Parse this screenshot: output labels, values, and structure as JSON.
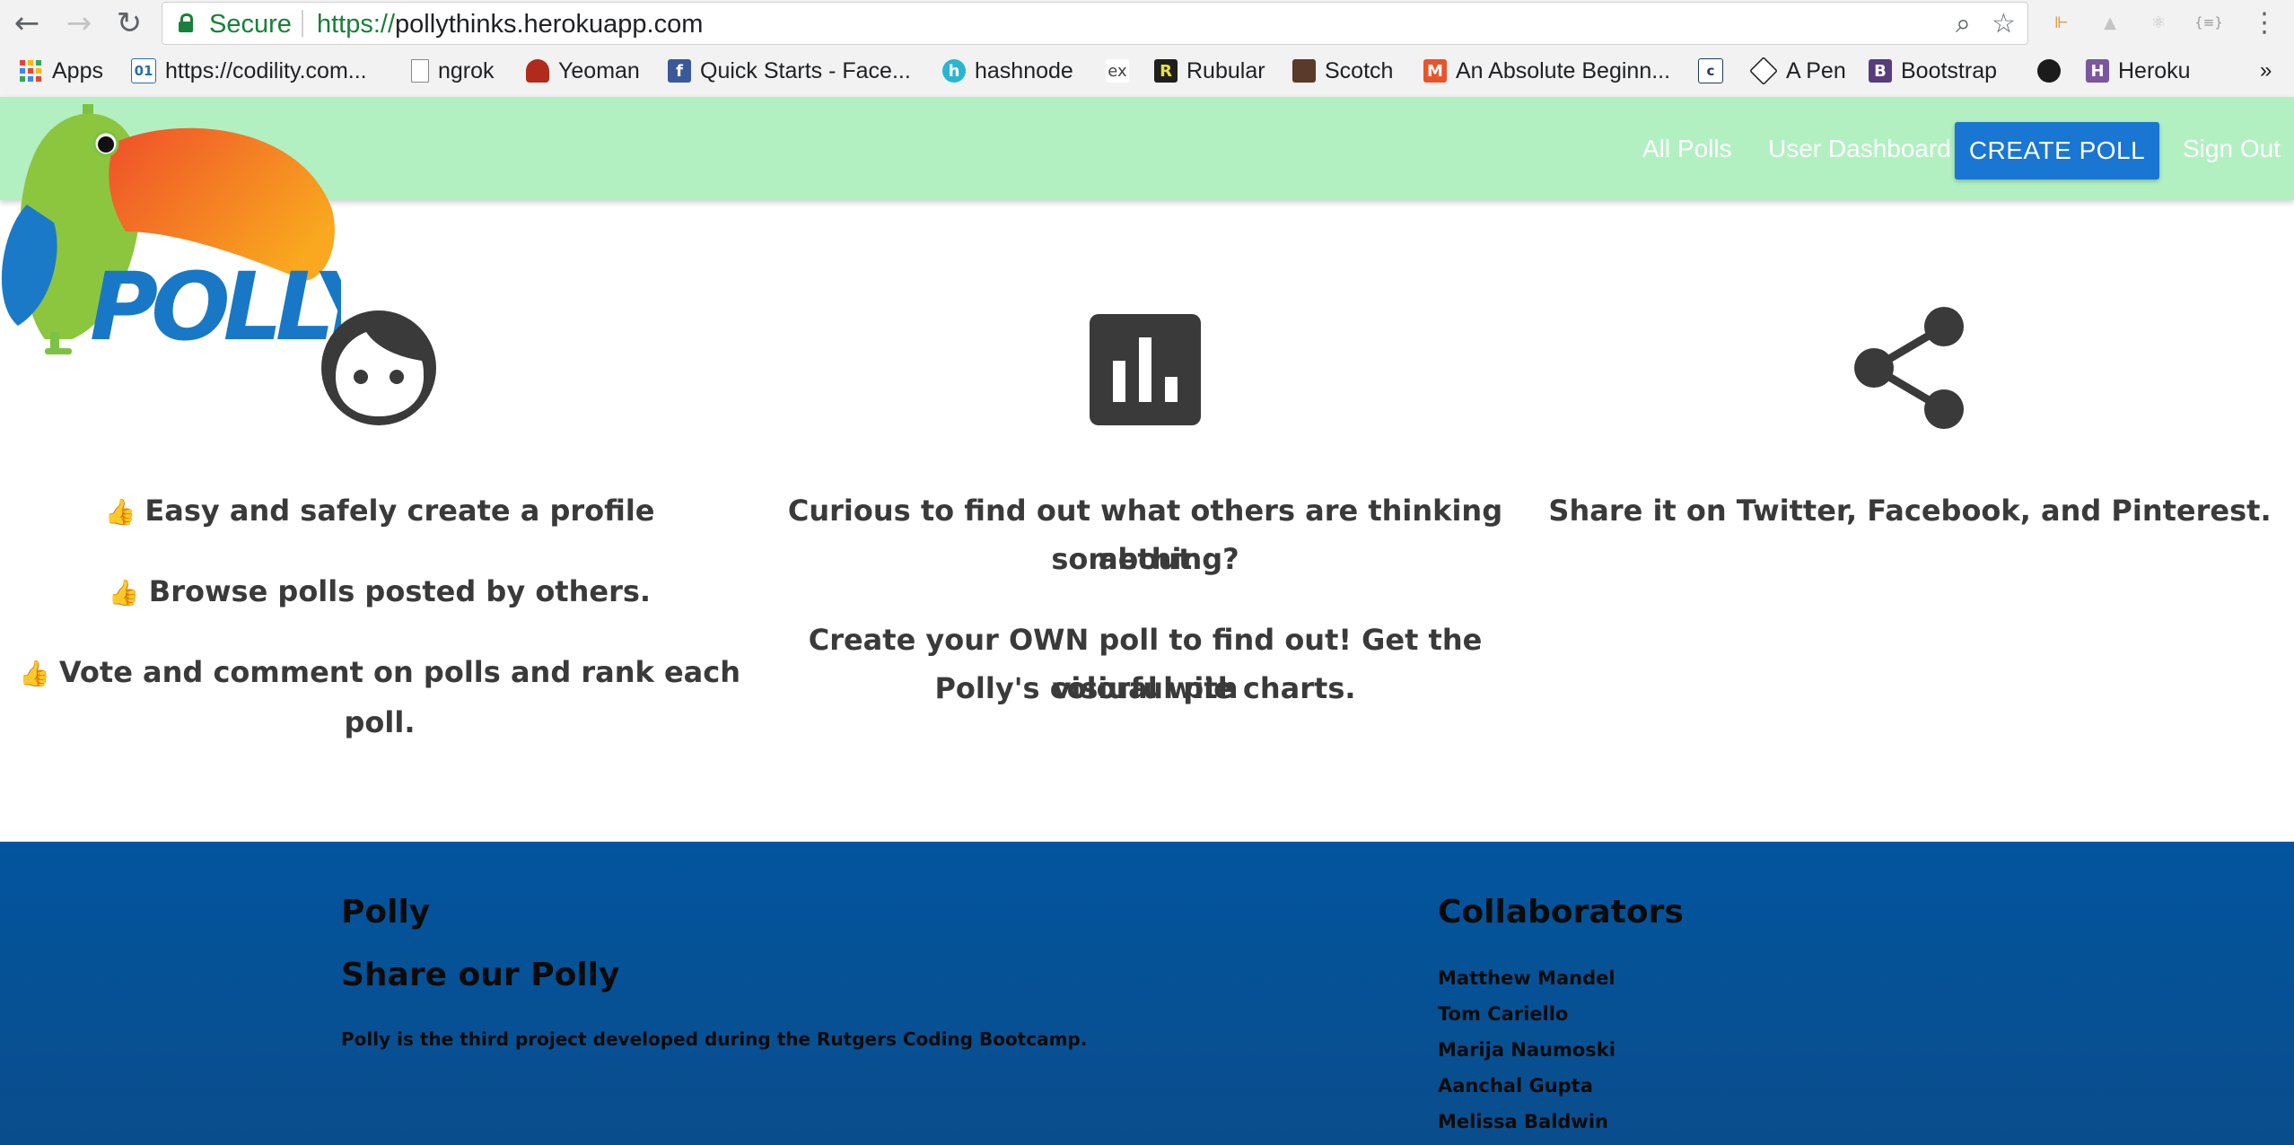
{
  "browser": {
    "secure_label": "Secure",
    "url_scheme": "https://",
    "url_host": "pollythinks.herokuapp.com",
    "back_icon": "back-arrow-icon",
    "forward_icon": "forward-arrow-icon",
    "reload_icon": "reload-icon"
  },
  "bookmarks": [
    {
      "label": "Apps",
      "icon": "apps-grid-icon"
    },
    {
      "label": "https://codility.com...",
      "icon": "codility-icon"
    },
    {
      "label": "ngrok",
      "icon": "page-icon"
    },
    {
      "label": "Yeoman",
      "icon": "yeoman-icon"
    },
    {
      "label": "Quick Starts - Face...",
      "icon": "facebook-icon"
    },
    {
      "label": "hashnode",
      "icon": "hashnode-icon"
    },
    {
      "label": "",
      "icon": "express-icon"
    },
    {
      "label": "Rubular",
      "icon": "rubular-icon"
    },
    {
      "label": "Scotch",
      "icon": "scotch-icon"
    },
    {
      "label": "An Absolute Beginn...",
      "icon": "medium-icon"
    },
    {
      "label": "",
      "icon": "codecademy-icon"
    },
    {
      "label": "A Pen",
      "icon": "codepen-icon"
    },
    {
      "label": "Bootstrap",
      "icon": "bootstrap-icon"
    },
    {
      "label": "",
      "icon": "github-icon"
    },
    {
      "label": "Heroku",
      "icon": "heroku-icon"
    }
  ],
  "nav": {
    "all_polls": "All Polls",
    "user_dashboard": "User Dashboard",
    "create_poll": "CREATE POLL",
    "sign_out": "Sign Out",
    "logo_text": "POLLY"
  },
  "features": {
    "col1": [
      "Easy and safely create a profile",
      "Browse polls posted by others.",
      "Vote and comment on polls and rank each poll."
    ],
    "col2": {
      "line1": "Curious to find out what others are thinking about",
      "line2": "something?",
      "line3": "Create your OWN poll to find out! Get the visiual with",
      "line4": "Polly's colorful pie charts."
    },
    "col3": "Share it on Twitter, Facebook, and Pinterest."
  },
  "footer": {
    "title": "Polly",
    "subtitle": "Share our Polly",
    "description": "Polly is the third project developed during the Rutgers Coding Bootcamp.",
    "collaborators_title": "Collaborators",
    "collaborators": [
      "Matthew Mandel",
      "Tom Cariello",
      "Marija Naumoski",
      "Aanchal Gupta",
      "Melissa Baldwin"
    ]
  },
  "colors": {
    "nav_bg": "#b2f0c2",
    "button_blue": "#1976d2",
    "footer_blue": "#02559e",
    "feature_text": "#3a3a3a"
  }
}
